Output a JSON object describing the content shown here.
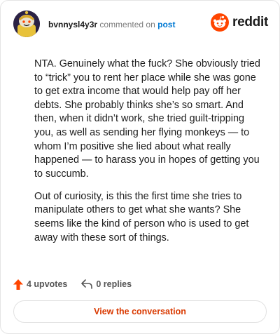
{
  "header": {
    "username": "bvnnysl4y3r",
    "commented_text": "commented on",
    "post_link": "post",
    "brand": "reddit"
  },
  "comment": {
    "paragraphs": [
      "NTA. Genuinely what the fuck? She obviously tried to “trick” you to rent her place while she was gone to get extra income that would help pay off her debts. She probably thinks she’s so smart. And then, when it didn’t work, she tried guilt-tripping you, as well as sending her flying monkeys — to whom I’m positive she lied about what really happened — to harass you in hopes of getting you to succumb.",
      "Out of curiosity, is this the first time she tries to manipulate others to get what she wants? She seems like the kind of person who is used to get away with these sort of things."
    ]
  },
  "actions": {
    "upvotes": "4 upvotes",
    "replies": "0 replies"
  },
  "cta": {
    "label": "View the conversation"
  },
  "colors": {
    "brand_orange": "#ff4500",
    "link_blue": "#0079d3",
    "cta_text": "#d93900"
  }
}
